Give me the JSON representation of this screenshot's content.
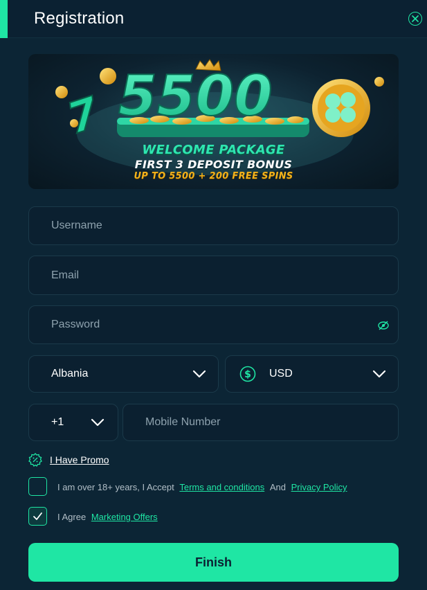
{
  "header": {
    "title": "Registration"
  },
  "banner": {
    "amount": "5500",
    "line1": "WELCOME PACKAGE",
    "line2": "FIRST 3 DEPOSIT BONUS",
    "line3": "UP TO 5500 + 200 FREE SPINS"
  },
  "form": {
    "username_placeholder": "Username",
    "email_placeholder": "Email",
    "password_placeholder": "Password",
    "country": "Albania",
    "currency": "USD",
    "phone_code": "+1",
    "mobile_placeholder": "Mobile Number"
  },
  "promo": {
    "label": "I Have Promo"
  },
  "terms": {
    "prefix": "I am over 18+ years, I Accept",
    "terms_link": "Terms and conditions",
    "and": "And",
    "privacy_link": "Privacy Policy",
    "checked": false
  },
  "marketing": {
    "prefix": "I Agree",
    "link": "Marketing Offers",
    "checked": true
  },
  "finish_label": "Finish",
  "colors": {
    "accent": "#1fe6a4",
    "background": "#0c2535",
    "field_border": "#1b3a4a",
    "gold": "#f2b21b"
  },
  "icons": {
    "close": "close-icon",
    "password_toggle": "eye-icon",
    "currency": "dollar-icon",
    "promo": "percent-icon",
    "dropdown": "chevron-down-icon",
    "check": "check-icon"
  }
}
